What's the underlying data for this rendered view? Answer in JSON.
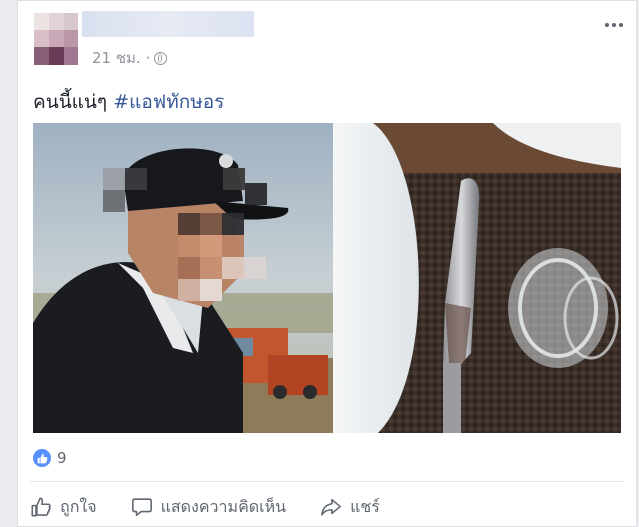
{
  "post": {
    "time": "21 ชม. ·",
    "text": "คนนี้แน่ๆ",
    "hashtag": "#แอฟทักษอร"
  },
  "reactions": {
    "like_count": "9"
  },
  "actions": {
    "like_label": "ถูกใจ",
    "comment_label": "แสดงความคิดเห็น",
    "share_label": "แชร์"
  },
  "colors": {
    "accent": "#365899",
    "like_badge": "#5890ff",
    "muted_text": "#90949c"
  },
  "icons": {
    "more": "more-options-icon",
    "audience": "globe-icon",
    "like": "thumbs-up-icon",
    "comment": "speech-bubble-icon",
    "share": "share-arrow-icon"
  }
}
